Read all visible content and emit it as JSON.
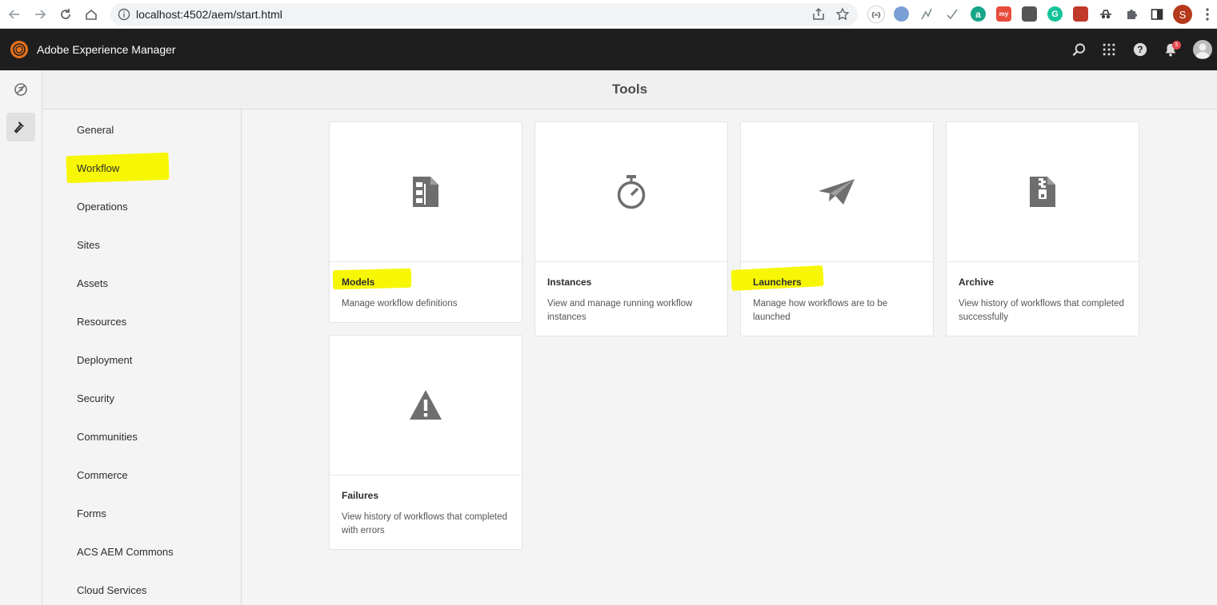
{
  "browser": {
    "url": "localhost:4502/aem/start.html",
    "profile_initial": "S",
    "extensions": [
      "json-viewer-icon",
      "ext-blue-icon",
      "ext-arrow-icon",
      "ext-check-icon",
      "ext-green-a-icon",
      "ext-red-icon",
      "ext-grey-icon",
      "grammarly-icon",
      "ext-dots-icon",
      "ext-spy-icon",
      "puzzle-icon",
      "sidepanel-icon"
    ]
  },
  "shell": {
    "title": "Adobe Experience Manager",
    "notification_count": "5"
  },
  "page": {
    "title": "Tools"
  },
  "categories": [
    {
      "label": "General"
    },
    {
      "label": "Workflow",
      "highlighted": true
    },
    {
      "label": "Operations"
    },
    {
      "label": "Sites"
    },
    {
      "label": "Assets"
    },
    {
      "label": "Resources"
    },
    {
      "label": "Deployment"
    },
    {
      "label": "Security"
    },
    {
      "label": "Communities"
    },
    {
      "label": "Commerce"
    },
    {
      "label": "Forms"
    },
    {
      "label": "ACS AEM Commons"
    },
    {
      "label": "Cloud Services"
    }
  ],
  "cards": [
    {
      "title": "Models",
      "description": "Manage workflow definitions",
      "icon": "workflow-models-icon",
      "highlighted": true
    },
    {
      "title": "Instances",
      "description": "View and manage running workflow instances",
      "icon": "stopwatch-icon"
    },
    {
      "title": "Launchers",
      "description": "Manage how workflows are to be launched",
      "icon": "paper-plane-icon",
      "highlighted": true
    },
    {
      "title": "Archive",
      "description": "View history of workflows that completed successfully",
      "icon": "archive-icon"
    },
    {
      "title": "Failures",
      "description": "View history of workflows that completed with errors",
      "icon": "alert-icon"
    }
  ],
  "colors": {
    "highlight": "#f7f705",
    "shell_bg": "#1e1e1e",
    "icon_grey": "#6e6e6e"
  }
}
